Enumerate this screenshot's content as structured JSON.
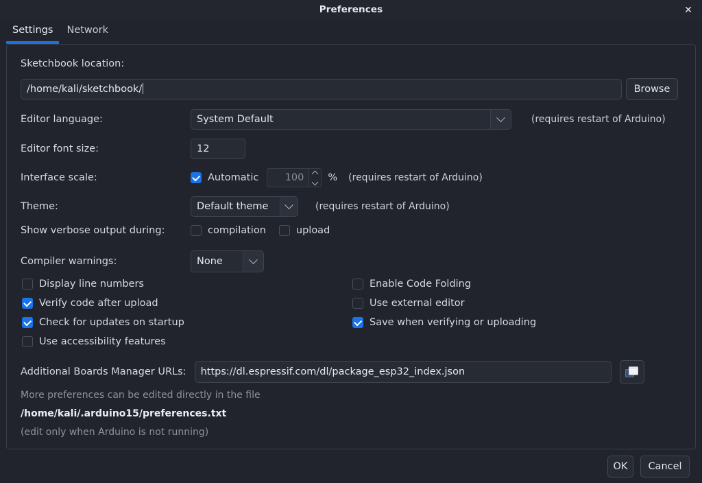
{
  "window": {
    "title": "Preferences",
    "close_icon": "close-icon"
  },
  "tabs": [
    {
      "label": "Settings",
      "active": true
    },
    {
      "label": "Network",
      "active": false
    }
  ],
  "settings": {
    "sketchbook": {
      "label": "Sketchbook location:",
      "value": "/home/kali/sketchbook/",
      "browse_label": "Browse"
    },
    "editor_language": {
      "label": "Editor language:",
      "value": "System Default",
      "note": "(requires restart of Arduino)"
    },
    "editor_font_size": {
      "label": "Editor font size:",
      "value": "12"
    },
    "interface_scale": {
      "label": "Interface scale:",
      "automatic_label": "Automatic",
      "automatic_checked": true,
      "value": "100",
      "percent_symbol": "%",
      "note": "(requires restart of Arduino)"
    },
    "theme": {
      "label": "Theme:",
      "value": "Default theme",
      "note": "(requires restart of Arduino)"
    },
    "verbose": {
      "label": "Show verbose output during:",
      "options": [
        {
          "label": "compilation",
          "checked": false
        },
        {
          "label": "upload",
          "checked": false
        }
      ]
    },
    "compiler_warnings": {
      "label": "Compiler warnings:",
      "value": "None"
    },
    "checkboxes_left": [
      {
        "label": "Display line numbers",
        "checked": false
      },
      {
        "label": "Verify code after upload",
        "checked": true
      },
      {
        "label": "Check for updates on startup",
        "checked": true
      },
      {
        "label": "Use accessibility features",
        "checked": false
      }
    ],
    "checkboxes_right": [
      {
        "label": "Enable Code Folding",
        "checked": false
      },
      {
        "label": "Use external editor",
        "checked": false
      },
      {
        "label": "Save when verifying or uploading",
        "checked": true
      }
    ],
    "boards_urls": {
      "label": "Additional Boards Manager URLs:",
      "value": "https://dl.espressif.com/dl/package_esp32_index.json",
      "expand_icon": "window-stack-icon"
    },
    "footer": {
      "line1": "More preferences can be edited directly in the file",
      "line2": "/home/kali/.arduino15/preferences.txt",
      "line3": "(edit only when Arduino is not running)"
    }
  },
  "actions": {
    "ok_label": "OK",
    "cancel_label": "Cancel"
  },
  "colors": {
    "background": "#21242c",
    "accent": "#1f6fe0",
    "checkbox_on": "#1a73e8",
    "field_bg": "#272b34",
    "border": "#3e434f"
  }
}
